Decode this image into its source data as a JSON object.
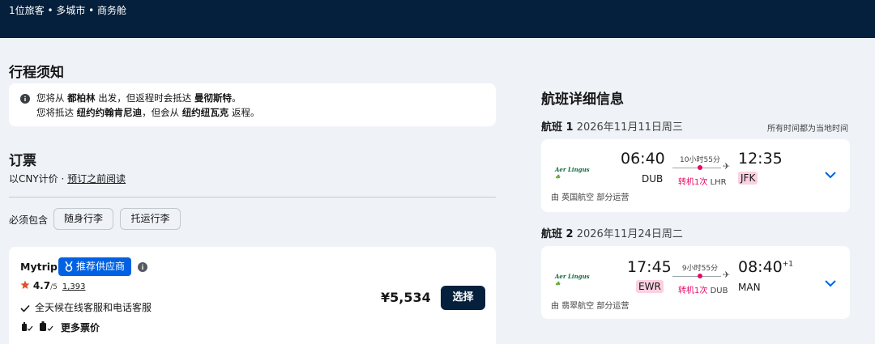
{
  "header": {
    "summary": "1位旅客 • 多城市 • 商务舱"
  },
  "itinerary_notice": {
    "title": "行程须知",
    "line1": {
      "p1": "您将从 ",
      "city1": "都柏林",
      "p2": " 出发，但返程时会抵达 ",
      "city2": "曼彻斯特",
      "p3": "。"
    },
    "line2": {
      "p1": "您将抵达 ",
      "city1": "纽约约翰肯尼迪",
      "p2": "，但会从 ",
      "city2": "纽约纽瓦克",
      "p3": " 返程。"
    }
  },
  "booking": {
    "title": "订票",
    "price_note": "以CNY计价 · ",
    "read_before": "预订之前阅读",
    "required_label": "必须包含",
    "chips": [
      "随身行李",
      "托运行李"
    ]
  },
  "provider": {
    "name": "Mytrip",
    "badge": "推荐供应商",
    "rating": "4.7",
    "rating_scale": "/5",
    "review_count": "1,393",
    "feature": "全天候在线客服和电话客服",
    "more_prices": "更多票价",
    "price": "¥5,534",
    "select_label": "选择"
  },
  "flight_details": {
    "title": "航班详细信息",
    "timezone_note": "所有时间都为当地时间",
    "flights": [
      {
        "label": "航班 1",
        "date": "2026年11月11日周三",
        "airline": "Aer Lingus",
        "dep_time": "06:40",
        "dep_code": "DUB",
        "duration": "10小时55分",
        "stops": "转机1次",
        "via": "LHR",
        "arr_time": "12:35",
        "arr_suffix": "",
        "arr_code": "JFK",
        "operator": "由 英国航空 部分运营"
      },
      {
        "label": "航班 2",
        "date": "2026年11月24日周二",
        "airline": "Aer Lingus",
        "dep_time": "17:45",
        "dep_code": "EWR",
        "duration": "9小时55分",
        "stops": "转机1次",
        "via": "DUB",
        "arr_time": "08:40",
        "arr_suffix": "+1",
        "arr_code": "MAN",
        "operator": "由 翡翠航空 部分运营"
      }
    ]
  },
  "colors": {
    "navy": "#05203c",
    "accent": "#0062e3",
    "stop_pink": "#e70866",
    "highlight": "#fbd0e1"
  }
}
